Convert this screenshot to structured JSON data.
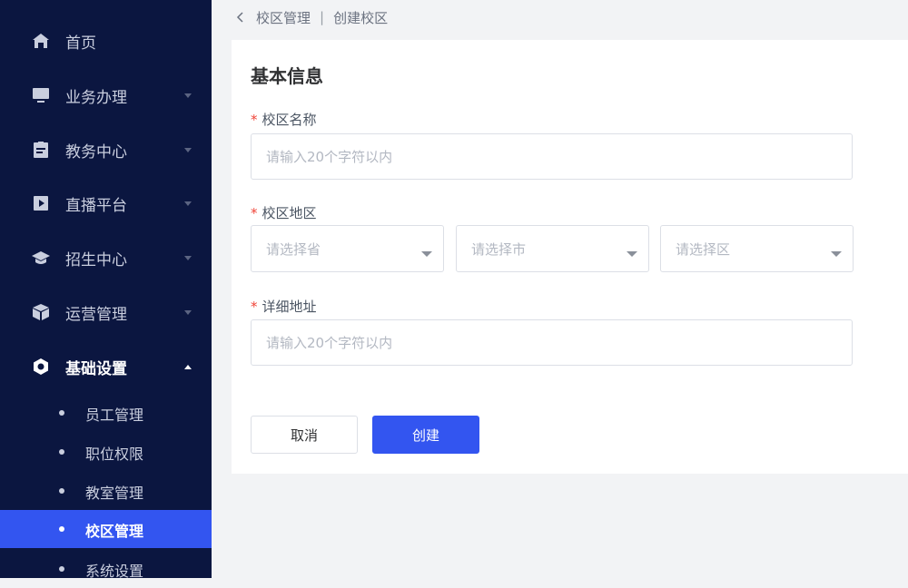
{
  "sidebar": {
    "items": [
      {
        "label": "首页",
        "icon": "home-icon"
      },
      {
        "label": "业务办理",
        "icon": "monitor-icon"
      },
      {
        "label": "教务中心",
        "icon": "clipboard-icon"
      },
      {
        "label": "直播平台",
        "icon": "play-icon"
      },
      {
        "label": "招生中心",
        "icon": "graduation-cap-icon"
      },
      {
        "label": "运营管理",
        "icon": "box-icon"
      },
      {
        "label": "基础设置",
        "icon": "settings-hexagon-icon"
      }
    ],
    "sub_items": [
      {
        "label": "员工管理"
      },
      {
        "label": "职位权限"
      },
      {
        "label": "教室管理"
      },
      {
        "label": "校区管理",
        "active": true
      },
      {
        "label": "系统设置"
      }
    ]
  },
  "breadcrumb": {
    "parent": "校区管理",
    "separator": "|",
    "current": "创建校区"
  },
  "form": {
    "title": "基本信息",
    "required_mark": "*",
    "campus_name": {
      "label": "校区名称",
      "value": "",
      "placeholder": "请输入20个字符以内"
    },
    "campus_region": {
      "label": "校区地区",
      "province_placeholder": "请选择省",
      "city_placeholder": "请选择市",
      "district_placeholder": "请选择区"
    },
    "detail_address": {
      "label": "详细地址",
      "value": "",
      "placeholder": "请输入20个字符以内"
    },
    "cancel_label": "取消",
    "create_label": "创建"
  },
  "colors": {
    "sidebar_bg": "#0b1640",
    "accent": "#3355f0",
    "required": "#f04438"
  }
}
